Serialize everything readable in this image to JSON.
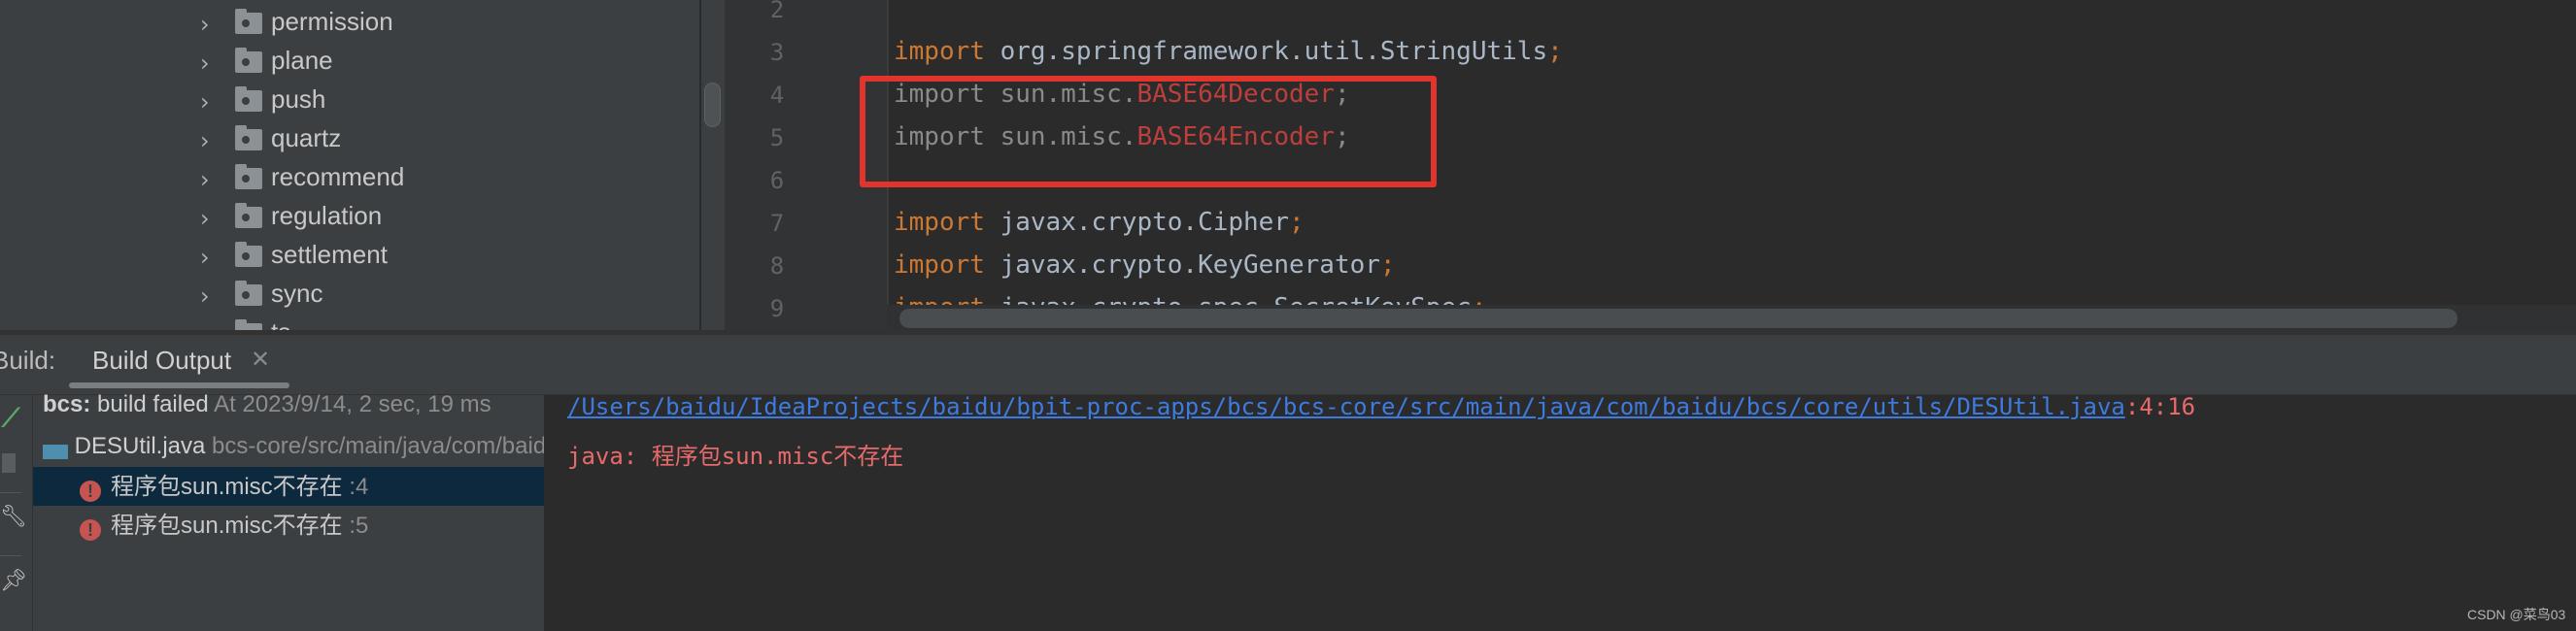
{
  "project_tree": {
    "items": [
      "permission",
      "plane",
      "push",
      "quartz",
      "recommend",
      "regulation",
      "settlement",
      "sync",
      "ts"
    ]
  },
  "editor": {
    "lines": [
      {
        "num": "2",
        "parts": []
      },
      {
        "num": "3",
        "parts": [
          {
            "t": "import",
            "c": "kw"
          },
          {
            "t": " org.springframework.util.StringUtils",
            "c": ""
          },
          {
            "t": ";",
            "c": "kw"
          }
        ]
      },
      {
        "num": "4",
        "parts": [
          {
            "t": "import sun.misc.",
            "c": "gr"
          },
          {
            "t": "BASE64Decoder",
            "c": "err"
          },
          {
            "t": ";",
            "c": "gr"
          }
        ]
      },
      {
        "num": "5",
        "parts": [
          {
            "t": "import sun.misc.",
            "c": "gr"
          },
          {
            "t": "BASE64Encoder",
            "c": "err"
          },
          {
            "t": ";",
            "c": "gr"
          }
        ]
      },
      {
        "num": "6",
        "parts": []
      },
      {
        "num": "7",
        "parts": [
          {
            "t": "import",
            "c": "kw"
          },
          {
            "t": " javax.crypto.Cipher",
            "c": ""
          },
          {
            "t": ";",
            "c": "kw"
          }
        ]
      },
      {
        "num": "8",
        "parts": [
          {
            "t": "import",
            "c": "kw"
          },
          {
            "t": " javax.crypto.KeyGenerator",
            "c": ""
          },
          {
            "t": ";",
            "c": "kw"
          }
        ]
      },
      {
        "num": "9",
        "parts": [
          {
            "t": "import",
            "c": "kw"
          },
          {
            "t": " javax.crypto.spec.SecretKeySpec",
            "c": ""
          },
          {
            "t": ";",
            "c": "kw"
          }
        ]
      }
    ]
  },
  "build": {
    "label": "Build:",
    "tab": "Build Output",
    "summary_name": "bcs:",
    "summary_status": " build failed",
    "summary_meta": " At 2023/9/14, 2 sec, 19 ms",
    "file": "DESUtil.java",
    "file_path": " bcs-core/src/main/java/com/baidu/bcs/core/utils",
    "errors": [
      {
        "text": "程序包sun.misc不存在",
        "line": " :4"
      },
      {
        "text": "程序包sun.misc不存在",
        "line": " :5"
      }
    ],
    "output_link": "/Users/baidu/IdeaProjects/baidu/bpit-proc-apps/bcs/bcs-core/src/main/java/com/baidu/bcs/core/utils/DESUtil.java",
    "output_pos": ":4:16",
    "output_msg": "java: 程序包sun.misc不存在"
  },
  "watermark": "CSDN @菜鸟03",
  "colors": {
    "highlight_box": "#e0342c",
    "error": "#e86a6a",
    "link": "#3d7be0",
    "keyword": "#cc7832"
  }
}
